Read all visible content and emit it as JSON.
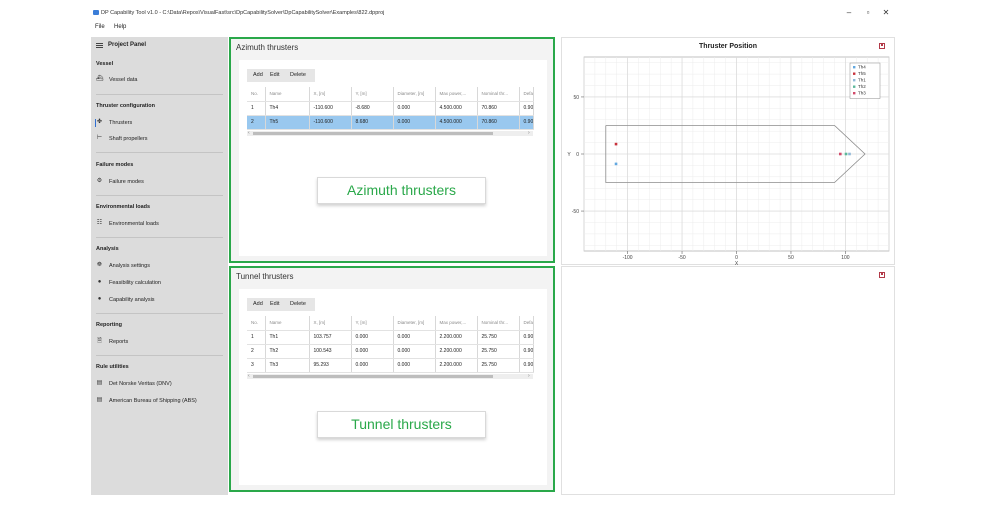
{
  "window": {
    "title": "DP Capability Tool v1.0 - C:\\Data\\Repos\\VisualFast\\src\\DpCapabilitySolver\\DpCapabilitySolver\\Examples\\822.dpproj",
    "minimize": "–",
    "maximize": "▫",
    "close": "✕"
  },
  "menu": {
    "file": "File",
    "help": "Help"
  },
  "sidebar": {
    "title": "Project Panel",
    "sections": {
      "vessel": "Vessel",
      "thruster_config": "Thruster configuration",
      "failure_modes": "Failure modes",
      "env_loads": "Environmental loads",
      "analysis": "Analysis",
      "reporting": "Reporting",
      "rule_utilities": "Rule utilities"
    },
    "items": {
      "vessel_data": "Vessel data",
      "thrusters": "Thrusters",
      "shaft_propellers": "Shaft propellers",
      "failure_modes": "Failure modes",
      "environmental_loads": "Environmental loads",
      "analysis_settings": "Analysis settings",
      "feasibility_calculation": "Feasibility calculation",
      "capability_analysis": "Capability analysis",
      "reports": "Reports",
      "dnv": "Det Norske Veritas (DNV)",
      "abs": "American Bureau of Shipping (ABS)"
    }
  },
  "azimuth": {
    "title": "Azimuth thrusters",
    "toolbar": {
      "add": "Add",
      "edit": "Edit",
      "delete": "Delete"
    },
    "columns": [
      "No.",
      "Name",
      "X, [m]",
      "Y, [m]",
      "Diameter, [m]",
      "Max power,...",
      "Nominal thr...",
      "Default th"
    ],
    "rows": [
      [
        "1",
        "Th4",
        "-110.600",
        "-8.680",
        "0.000",
        "4.500.000",
        "70.860",
        "0.900"
      ],
      [
        "2",
        "Th5",
        "-110.600",
        "8.680",
        "0.000",
        "4.500.000",
        "70.860",
        "0.900"
      ]
    ],
    "callout": "Azimuth thrusters"
  },
  "tunnel": {
    "title": "Tunnel thrusters",
    "toolbar": {
      "add": "Add",
      "edit": "Edit",
      "delete": "Delete"
    },
    "columns": [
      "No.",
      "Name",
      "X, [m]",
      "Y, [m]",
      "Diameter, [m]",
      "Max power,...",
      "Nominal thr...",
      "Default th"
    ],
    "rows": [
      [
        "1",
        "Th1",
        "103.757",
        "0.000",
        "0.000",
        "2.200.000",
        "25.750",
        "0.900"
      ],
      [
        "2",
        "Th2",
        "100.543",
        "0.000",
        "0.000",
        "2.200.000",
        "25.750",
        "0.900"
      ],
      [
        "3",
        "Th3",
        "95.293",
        "0.000",
        "0.000",
        "2.200.000",
        "25.750",
        "0.900"
      ]
    ],
    "callout": "Tunnel thrusters"
  },
  "chart_data": {
    "type": "scatter",
    "title": "Thruster Position",
    "xlabel": "X",
    "ylabel": "Y",
    "xlim": [
      -140,
      140
    ],
    "ylim": [
      -85,
      85
    ],
    "xticks": [
      -100,
      -50,
      0,
      50,
      100
    ],
    "yticks": [
      -50,
      0,
      50
    ],
    "grid": true,
    "legend_position": "top-right",
    "series": [
      {
        "name": "Th4",
        "color": "#62a8e0",
        "x": [
          -110.6
        ],
        "y": [
          -8.68
        ]
      },
      {
        "name": "Th5",
        "color": "#c8323c",
        "x": [
          -110.6
        ],
        "y": [
          8.68
        ]
      },
      {
        "name": "Th1",
        "color": "#8fb8d8",
        "x": [
          103.757
        ],
        "y": [
          0
        ]
      },
      {
        "name": "Th2",
        "color": "#5cb89a",
        "x": [
          100.543
        ],
        "y": [
          0
        ]
      },
      {
        "name": "Th3",
        "color": "#d24a6a",
        "x": [
          95.293
        ],
        "y": [
          0
        ]
      }
    ],
    "hull_outline": {
      "x": [
        -120,
        90,
        118,
        90,
        -120,
        -120
      ],
      "y": [
        25,
        25,
        0,
        -25,
        -25,
        25
      ]
    }
  },
  "colors": {
    "highlight": "#2aa84a",
    "selected_row": "#99c8ef",
    "sidebar_bg": "#dcdcdc"
  }
}
